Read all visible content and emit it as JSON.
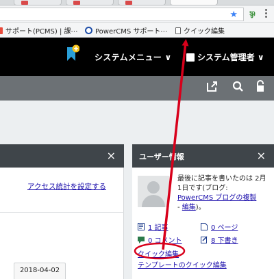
{
  "browser": {
    "bookmarks": [
      {
        "label": "サポート(PCMS) | 課⋯",
        "icon": "red-doc-icon"
      },
      {
        "label": "PowerCMS サポート⋯",
        "icon": "powercms-icon"
      },
      {
        "label": "クイック編集",
        "icon": "page-icon"
      }
    ]
  },
  "header": {
    "system_menu": "システムメニュー ∨",
    "system_admin": "システム管理者 ∨"
  },
  "left_panel": {
    "close": "×",
    "analytics_link": "アクセス統計を設定する",
    "date_tab": "2018-04-02"
  },
  "user_panel": {
    "title": "ユーザー情報",
    "close": "×",
    "info_prefix": "最後に記事を書いたのは 2月 1日です(ブログ:",
    "blog_link": "PowerCMS ブログの複製",
    "edit_prefix": "- ",
    "edit_link": "編集",
    "edit_suffix": ")。",
    "stats": {
      "entries": "1 記事",
      "pages": "0 ページ",
      "comments": "0 コメント",
      "drafts": "8 下書き"
    },
    "quick_edit": "クイック編集",
    "template_quick_edit": "テンプレートのクイック編集"
  },
  "colors": {
    "annotation": "#d8001b",
    "link": "#1a0dab",
    "header_bg": "#000000",
    "toolbar_bg": "#6c7175",
    "panel_head_bg": "#3f454a"
  }
}
